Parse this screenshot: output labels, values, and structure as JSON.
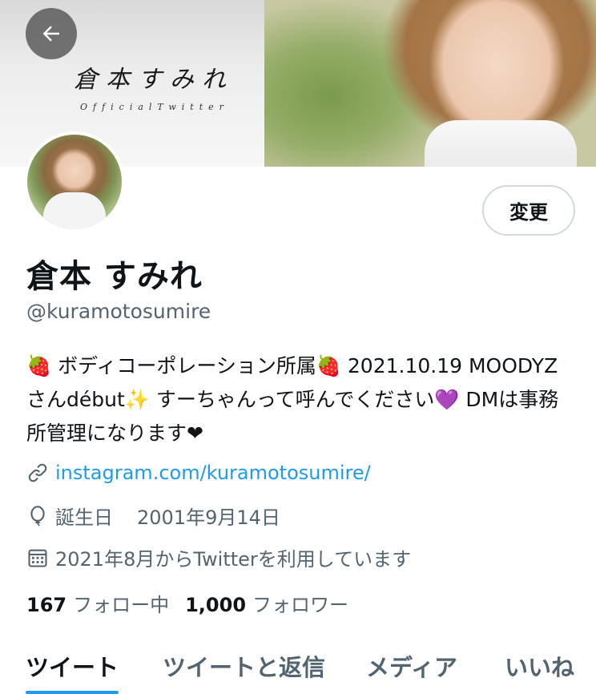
{
  "banner": {
    "title": "倉本すみれ",
    "subtitle": "OfficialTwitter"
  },
  "profile": {
    "edit_label": "変更",
    "name": "倉本 すみれ",
    "handle": "@kuramotosumire",
    "bio": "🍓 ボディコーポレーション所属🍓 2021.10.19 MOODYZさんdébut✨ すーちゃんって呼んでください💜 DMは事務所管理になります❤",
    "link": "instagram.com/kuramotosumire/",
    "birthday_label": "誕生日",
    "birthday_value": "2001年9月14日",
    "joined": "2021年8月からTwitterを利用しています"
  },
  "stats": {
    "following_count": "167",
    "following_label": "フォロー中",
    "followers_count": "1,000",
    "followers_label": "フォロワー"
  },
  "tabs": [
    {
      "label": "ツイート",
      "active": true
    },
    {
      "label": "ツイートと返信",
      "active": false
    },
    {
      "label": "メディア",
      "active": false
    },
    {
      "label": "いいね",
      "active": false
    }
  ],
  "icons": {
    "back": "arrow-left-icon",
    "link": "link-icon",
    "birthday": "balloon-icon",
    "joined": "calendar-icon"
  },
  "colors": {
    "accent": "#1d9bf0",
    "text": "#0f1419",
    "secondary": "#536471"
  }
}
